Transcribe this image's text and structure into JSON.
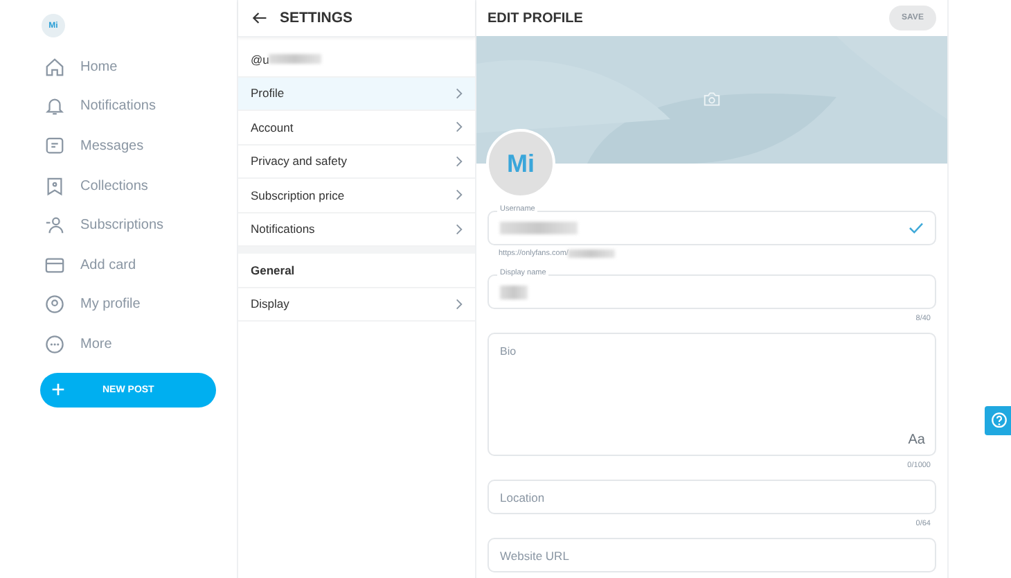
{
  "sidebar": {
    "avatar": "Mi",
    "items": [
      {
        "label": "Home",
        "selected": false
      },
      {
        "label": "Notifications",
        "selected": false
      },
      {
        "label": "Messages",
        "selected": false
      },
      {
        "label": "Collections",
        "selected": false
      },
      {
        "label": "Subscriptions",
        "selected": false
      },
      {
        "label": "Add card",
        "selected": false
      },
      {
        "label": "My profile",
        "selected": false
      },
      {
        "label": "More",
        "selected": false
      }
    ],
    "new_post_button": "NEW POST"
  },
  "settings": {
    "title": "SETTINGS",
    "handle": "@u",
    "items": [
      {
        "label": "Profile",
        "selected": true
      },
      {
        "label": "Account",
        "selected": false
      },
      {
        "label": "Privacy and safety",
        "selected": false
      },
      {
        "label": "Subscription price",
        "selected": false
      },
      {
        "label": "Notifications",
        "selected": false
      }
    ],
    "section": "General",
    "section_items": [
      {
        "label": "Display",
        "selected": false
      }
    ]
  },
  "edit_profile": {
    "title": "EDIT PROFILE",
    "save_button": {
      "label": "SAVE",
      "disabled": true
    },
    "avatar": "Mi",
    "username": {
      "label": "Username",
      "checked": true
    },
    "profile_url": "https://onlyfans.com/",
    "display_name": {
      "label": "Display name",
      "counter": "8/40"
    },
    "bio": {
      "placeholder": "Bio",
      "counter": "0/1000",
      "format_button": "Aa"
    },
    "location": {
      "placeholder": "Location",
      "counter": "0/64"
    },
    "website": {
      "placeholder": "Website URL"
    }
  }
}
